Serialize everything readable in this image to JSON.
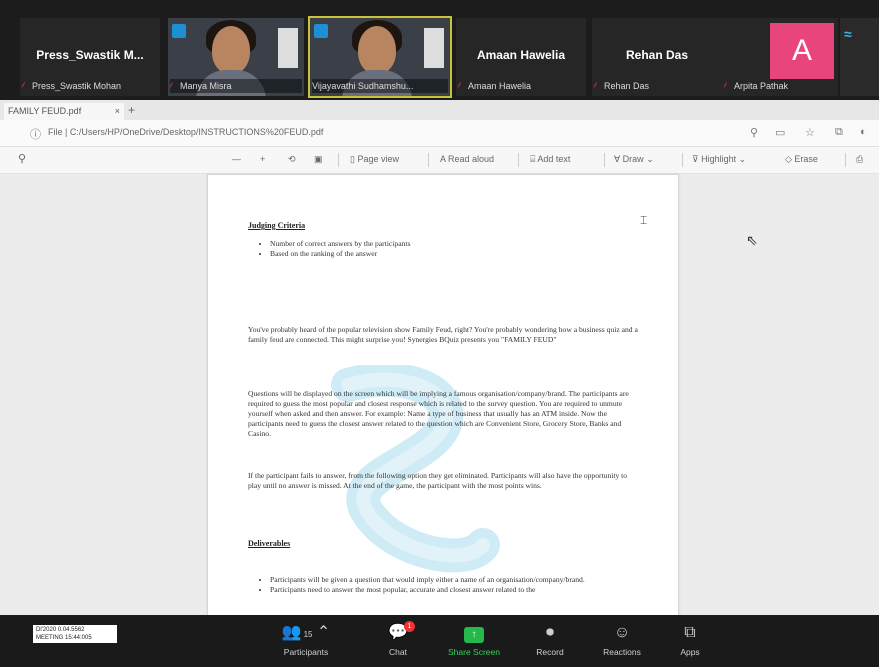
{
  "meeting": {
    "participants": [
      {
        "kind": "name",
        "display": "Press_Swastik  M...",
        "label": "Press_Swastik Mohan"
      },
      {
        "kind": "video",
        "label": "Manya Misra"
      },
      {
        "kind": "video",
        "label": "Vijayavathi Sudhamshu..."
      },
      {
        "kind": "name",
        "display": "Amaan Hawelia",
        "label": "Amaan Hawelia"
      },
      {
        "kind": "name",
        "display": "Rehan Das",
        "label": "Rehan Das"
      },
      {
        "kind": "avatar",
        "initial": "A",
        "label": "Arpita Pathak"
      }
    ],
    "controls": [
      {
        "icon": "participants-icon",
        "glyph": "👥",
        "count": "15",
        "label": "Participants"
      },
      {
        "icon": "chat-icon",
        "glyph": "💬",
        "badge": "1",
        "label": "Chat"
      },
      {
        "icon": "share-screen-icon",
        "glyph": "↑",
        "label": "Share Screen"
      },
      {
        "icon": "record-icon",
        "glyph": "⏺",
        "label": "Record"
      },
      {
        "icon": "reactions-icon",
        "glyph": "☺",
        "label": "Reactions"
      },
      {
        "icon": "apps-icon",
        "glyph": "⧉",
        "label": "Apps"
      }
    ],
    "badge_text": [
      "Dl'2020      0.04.5562",
      "MEETING      15:44:005"
    ]
  },
  "browser": {
    "tab_title": "FAMILY FEUD.pdf",
    "address": "File  |  C:/Users/HP/OneDrive/Desktop/INSTRUCTIONS%20FEUD.pdf",
    "toolbar": {
      "zoom_out": "—",
      "zoom_in": "+",
      "page_view": "Page view",
      "read_aloud": "Read aloud",
      "add_text": "Add text",
      "draw": "Draw",
      "highlight": "Highlight",
      "erase": "Erase"
    }
  },
  "document": {
    "judging_heading": "Judging Criteria",
    "judging_items": [
      "Number of correct answers by the participants",
      "Based on the ranking of the answer"
    ],
    "intro_paragraph": "You've probably heard of the popular television show Family Feud, right? You're probably wondering how a business quiz and a family feud are connected. This might surprise you! Synergies BQuiz presents you \"FAMILY FEUD\"",
    "rules_paragraph": "Questions will be displayed on the screen which will be implying a famous organisation/company/brand. The participants are required to guess the most popular and closest response which is related to the survey question. You are required to unmute yourself when asked and then answer. For example: Name a type of business that usually has an ATM inside. Now the participants need to guess the closest answer related to the question which are Convenient Store, Grocery Store, Banks and Casino.",
    "elimination_paragraph": "If the participant fails to answer, from the following option they get eliminated. Participants will also have the opportunity to play until no answer is missed. At the end of the game, the participant with the most points wins.",
    "deliverables_heading": "Deliverables",
    "deliverables_items": [
      "Participants will be given a question that would imply either a name of an organisation/company/brand.",
      "Participants need to answer the most popular, accurate and closest answer related to the"
    ]
  }
}
